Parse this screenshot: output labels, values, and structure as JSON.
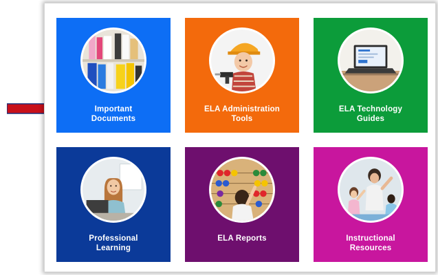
{
  "tiles": [
    {
      "line1": "Important",
      "line2": "Documents",
      "color": "#0d6ef5",
      "photo": "office-binders-shelf"
    },
    {
      "line1": "ELA Administration",
      "line2": "Tools",
      "color": "#f36a0c",
      "photo": "child-builder-with-drill"
    },
    {
      "line1": "ELA Technology",
      "line2": "Guides",
      "color": "#0c9c3a",
      "photo": "laptop-on-desk"
    },
    {
      "line1": "Professional",
      "line2": "Learning",
      "color": "#0b3a99",
      "photo": "woman-at-laptop"
    },
    {
      "line1": "ELA Reports",
      "line2": "",
      "color": "#6e0f6e",
      "photo": "child-with-abacus"
    },
    {
      "line1": "Instructional",
      "line2": "Resources",
      "color": "#c8169e",
      "photo": "teacher-with-children"
    }
  ],
  "annotation": {
    "icon": "red-arrow-icon",
    "color": "#c8101a"
  }
}
